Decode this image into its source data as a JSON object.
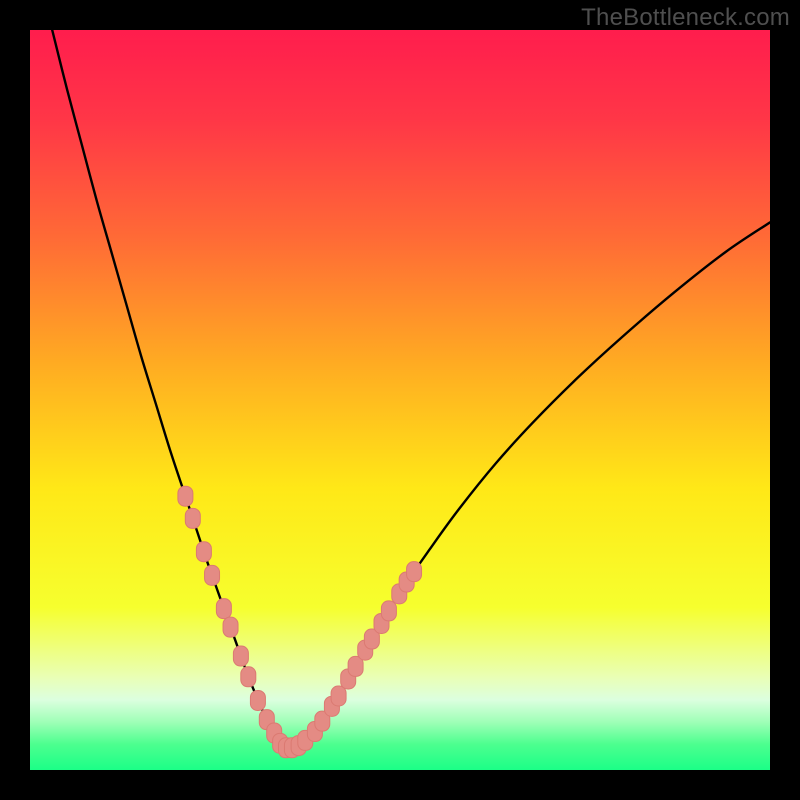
{
  "attribution": "TheBottleneck.com",
  "colors": {
    "frame": "#000000",
    "curve": "#000000",
    "marker_fill": "#e48b84",
    "marker_stroke": "#db7a72",
    "gradient_stops": [
      {
        "offset": 0.0,
        "color": "#ff1d4d"
      },
      {
        "offset": 0.12,
        "color": "#ff3647"
      },
      {
        "offset": 0.28,
        "color": "#ff6a36"
      },
      {
        "offset": 0.45,
        "color": "#ffab22"
      },
      {
        "offset": 0.62,
        "color": "#ffe817"
      },
      {
        "offset": 0.78,
        "color": "#f6ff2e"
      },
      {
        "offset": 0.875,
        "color": "#e9ffb6"
      },
      {
        "offset": 0.905,
        "color": "#dcffdf"
      },
      {
        "offset": 0.935,
        "color": "#9fffb7"
      },
      {
        "offset": 0.965,
        "color": "#4dff8f"
      },
      {
        "offset": 1.0,
        "color": "#1bff87"
      }
    ]
  },
  "chart_data": {
    "type": "line",
    "title": "",
    "xlabel": "",
    "ylabel": "",
    "xlim": [
      0,
      100
    ],
    "ylim": [
      0,
      100
    ],
    "curve": {
      "name": "bottleneck-curve",
      "x": [
        3,
        5,
        7,
        9,
        11,
        13,
        15,
        17,
        19,
        21,
        23,
        24,
        25,
        26,
        27,
        28,
        29,
        30,
        31,
        32,
        33,
        34.5,
        36,
        38,
        40,
        42,
        44,
        47,
        50,
        54,
        58,
        63,
        68,
        74,
        80,
        87,
        94,
        100
      ],
      "y": [
        100,
        92,
        84.5,
        77,
        70,
        63,
        56,
        49.5,
        43,
        37,
        31,
        28,
        25.2,
        22.4,
        19.6,
        16.8,
        14,
        11.4,
        9,
        6.8,
        5,
        3,
        3,
        4.5,
        7.3,
        10.5,
        14,
        19,
        24,
        29.8,
        35.3,
        41.5,
        47,
        53,
        58.5,
        64.5,
        70,
        74
      ]
    },
    "markers": [
      {
        "x": 21.0,
        "y": 37.0
      },
      {
        "x": 22.0,
        "y": 34.0
      },
      {
        "x": 23.5,
        "y": 29.5
      },
      {
        "x": 24.6,
        "y": 26.3
      },
      {
        "x": 26.2,
        "y": 21.8
      },
      {
        "x": 27.1,
        "y": 19.3
      },
      {
        "x": 28.5,
        "y": 15.4
      },
      {
        "x": 29.5,
        "y": 12.6
      },
      {
        "x": 30.8,
        "y": 9.4
      },
      {
        "x": 32.0,
        "y": 6.8
      },
      {
        "x": 33.0,
        "y": 5.0
      },
      {
        "x": 33.8,
        "y": 3.6
      },
      {
        "x": 34.6,
        "y": 3.0
      },
      {
        "x": 35.4,
        "y": 3.0
      },
      {
        "x": 36.3,
        "y": 3.3
      },
      {
        "x": 37.2,
        "y": 4.0
      },
      {
        "x": 38.5,
        "y": 5.2
      },
      {
        "x": 39.5,
        "y": 6.6
      },
      {
        "x": 40.8,
        "y": 8.6
      },
      {
        "x": 41.7,
        "y": 10.0
      },
      {
        "x": 43.0,
        "y": 12.3
      },
      {
        "x": 44.0,
        "y": 14.0
      },
      {
        "x": 45.3,
        "y": 16.2
      },
      {
        "x": 46.2,
        "y": 17.7
      },
      {
        "x": 47.5,
        "y": 19.8
      },
      {
        "x": 48.5,
        "y": 21.5
      },
      {
        "x": 49.9,
        "y": 23.8
      },
      {
        "x": 50.9,
        "y": 25.4
      },
      {
        "x": 51.9,
        "y": 26.8
      }
    ]
  }
}
